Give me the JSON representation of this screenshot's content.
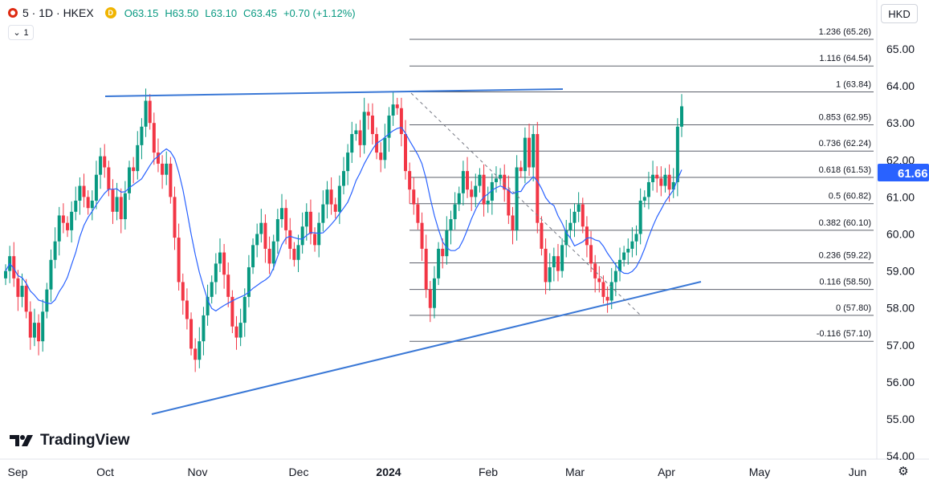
{
  "header": {
    "symbol": "5 · 1D · HKEX",
    "badge": "D",
    "open": "O63.15",
    "high": "H63.50",
    "low": "L63.10",
    "close": "C63.45",
    "change": "+0.70 (+1.12%)"
  },
  "indicator_toggle": "1",
  "currency": "HKD",
  "logo_text": "TradingView",
  "colors": {
    "up": "#089981",
    "down": "#f23645",
    "ma": "#2962ff",
    "trend": "#2962ff",
    "fib": "#787b86",
    "last_price_bg": "#2962ff"
  },
  "chart_data": {
    "type": "candlestick",
    "price_axis": {
      "min": 54.0,
      "max": 65.0,
      "ticks": [
        "54.00",
        "55.00",
        "56.00",
        "57.00",
        "58.00",
        "59.00",
        "60.00",
        "61.00",
        "62.00",
        "63.00",
        "64.00",
        "65.00"
      ]
    },
    "time_axis": {
      "labels": [
        {
          "text": "Sep",
          "bold": false
        },
        {
          "text": "Oct",
          "bold": false
        },
        {
          "text": "Nov",
          "bold": false
        },
        {
          "text": "Dec",
          "bold": false
        },
        {
          "text": "2024",
          "bold": true
        },
        {
          "text": "Feb",
          "bold": false
        },
        {
          "text": "Mar",
          "bold": false
        },
        {
          "text": "Apr",
          "bold": false
        },
        {
          "text": "May",
          "bold": false
        },
        {
          "text": "Jun",
          "bold": false
        }
      ]
    },
    "last_price": "61.66",
    "fib_levels": [
      {
        "ratio": "1.236",
        "price": 65.26
      },
      {
        "ratio": "1.116",
        "price": 64.54
      },
      {
        "ratio": "1",
        "price": 63.84
      },
      {
        "ratio": "0.853",
        "price": 62.95
      },
      {
        "ratio": "0.736",
        "price": 62.24
      },
      {
        "ratio": "0.618",
        "price": 61.53
      },
      {
        "ratio": "0.5",
        "price": 60.82
      },
      {
        "ratio": "0.382",
        "price": 60.1
      },
      {
        "ratio": "0.236",
        "price": 59.22
      },
      {
        "ratio": "0.116",
        "price": 58.5
      },
      {
        "ratio": "0",
        "price": 57.8
      },
      {
        "ratio": "-0.116",
        "price": 57.1
      }
    ],
    "closes": [
      59.0,
      59.4,
      58.8,
      58.3,
      58.6,
      57.9,
      57.2,
      57.6,
      57.1,
      57.9,
      58.5,
      59.3,
      59.8,
      60.5,
      60.3,
      60.1,
      60.6,
      60.9,
      61.3,
      61.0,
      60.7,
      60.9,
      61.6,
      62.1,
      61.8,
      61.2,
      60.6,
      61.0,
      60.4,
      61.1,
      61.8,
      61.7,
      62.4,
      62.9,
      63.6,
      63.0,
      62.2,
      61.9,
      61.6,
      61.9,
      61.0,
      59.9,
      58.7,
      58.2,
      57.7,
      56.9,
      56.6,
      57.1,
      57.8,
      58.3,
      58.7,
      59.2,
      59.5,
      58.9,
      58.3,
      57.5,
      57.2,
      57.6,
      58.3,
      59.1,
      59.7,
      60.0,
      60.3,
      59.6,
      59.2,
      59.8,
      60.4,
      60.7,
      60.1,
      59.6,
      59.3,
      59.7,
      60.2,
      60.6,
      60.0,
      59.7,
      60.3,
      60.8,
      61.2,
      60.8,
      60.6,
      61.3,
      61.7,
      62.2,
      62.7,
      62.8,
      62.4,
      63.3,
      63.2,
      62.7,
      62.2,
      62.0,
      62.6,
      63.2,
      63.5,
      63.4,
      62.7,
      61.7,
      61.2,
      60.8,
      60.3,
      59.6,
      58.5,
      58.0,
      58.8,
      59.6,
      59.4,
      60.1,
      60.4,
      60.8,
      61.1,
      61.7,
      61.2,
      61.0,
      61.3,
      61.6,
      60.8,
      60.9,
      61.4,
      61.5,
      61.6,
      61.2,
      60.5,
      60.1,
      61.8,
      61.7,
      62.6,
      61.8,
      62.7,
      60.3,
      59.6,
      58.7,
      59.1,
      59.4,
      59.0,
      59.7,
      60.1,
      60.3,
      60.6,
      60.8,
      60.2,
      59.7,
      59.2,
      58.8,
      58.7,
      58.3,
      58.2,
      58.7,
      59.0,
      59.3,
      59.5,
      59.6,
      59.8,
      60.0,
      60.9,
      61.0,
      61.4,
      61.6,
      61.5,
      61.3,
      61.6,
      61.2,
      61.4,
      62.9,
      63.45
    ]
  }
}
